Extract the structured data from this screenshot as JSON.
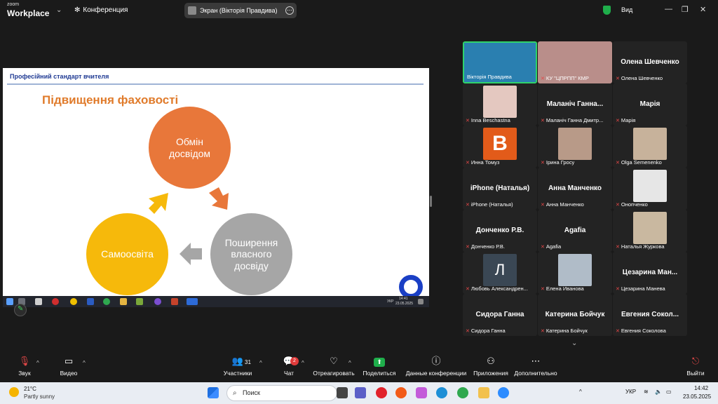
{
  "app": {
    "logo_line1": "zoom",
    "logo_line2": "Workplace",
    "meeting_title": "Конференция",
    "share_pill": "Экран (Вікторія Правдива)",
    "view_label": "Вид"
  },
  "slide": {
    "header": "Професійний стандарт вчителя",
    "title": "Підвищення фаховості",
    "circle_top": "Обмін досвідом",
    "circle_right": "Поширення власного досвіду",
    "circle_left": "Самоосвіта",
    "colors": {
      "orange": "#e8773a",
      "gray": "#a6a6a6",
      "yellow": "#f6b90b",
      "title": "#e07b2b"
    }
  },
  "shared_taskbar": {
    "lang": "УКР",
    "time": "14:41",
    "date": "23.05.2025"
  },
  "gallery": {
    "tiles": [
      {
        "label": "Вікторія Правдива",
        "big": "",
        "photo": true,
        "muted": false,
        "active": true
      },
      {
        "label": "КУ \"ЦПРПП\" КМР",
        "big": "",
        "photo": true,
        "muted": true,
        "active": false
      },
      {
        "label": "Олена Шевченко",
        "big": "Олена Шевченко",
        "photo": false,
        "muted": true
      },
      {
        "label": "Inna Beschastna",
        "big": "",
        "photo": true,
        "muted": true
      },
      {
        "label": "Маланіч Ганна Дмитр...",
        "big": "Маланіч Ганна...",
        "photo": false,
        "muted": true
      },
      {
        "label": "Марія",
        "big": "Марія",
        "photo": false,
        "muted": true
      },
      {
        "label": "Инна Томуз",
        "big": "",
        "photo": true,
        "muted": true
      },
      {
        "label": "Ірина Гросу",
        "big": "",
        "photo": true,
        "muted": true
      },
      {
        "label": "Olga Semenenko",
        "big": "",
        "photo": true,
        "muted": true
      },
      {
        "label": "iPhone (Наталья)",
        "big": "iPhone (Наталья)",
        "photo": false,
        "muted": true
      },
      {
        "label": "Анна Манченко",
        "big": "Анна Манченко",
        "photo": false,
        "muted": true
      },
      {
        "label": "Онопченко",
        "big": "",
        "photo": true,
        "muted": true
      },
      {
        "label": "Донченко Р.В.",
        "big": "Донченко Р.В.",
        "photo": false,
        "muted": true
      },
      {
        "label": "Agafia",
        "big": "Agafia",
        "photo": false,
        "muted": true
      },
      {
        "label": "Наталья Журкова",
        "big": "",
        "photo": true,
        "muted": true
      },
      {
        "label": "Любовь Александрен...",
        "big": "",
        "photo": true,
        "muted": true
      },
      {
        "label": "Елена Иванова",
        "big": "",
        "photo": true,
        "muted": true
      },
      {
        "label": "Цезарина Манева",
        "big": "Цезарина Ман...",
        "photo": false,
        "muted": true
      },
      {
        "label": "Сидора Ганна",
        "big": "Сидора Ганна",
        "photo": false,
        "muted": true
      },
      {
        "label": "Катерина Бойчук",
        "big": "Катерина Бойчук",
        "photo": false,
        "muted": true
      },
      {
        "label": "Евгения Соколова",
        "big": "Евгения Сокол...",
        "photo": false,
        "muted": true
      }
    ],
    "avatar_letter": "Л",
    "avatar_b": "B"
  },
  "toolbar": {
    "audio": "Звук",
    "video": "Видео",
    "participants": "Участники",
    "participants_count": "31",
    "chat": "Чат",
    "chat_badge": "2",
    "react": "Отреагировать",
    "share": "Поделиться",
    "info": "Данные конференции",
    "apps": "Приложения",
    "more": "Дополнительно",
    "leave": "Выйти"
  },
  "windows": {
    "temp": "21°C",
    "weather": "Partly sunny",
    "search_placeholder": "Поиск",
    "lang": "УКР",
    "time": "14:42",
    "date": "23.05.2025"
  }
}
